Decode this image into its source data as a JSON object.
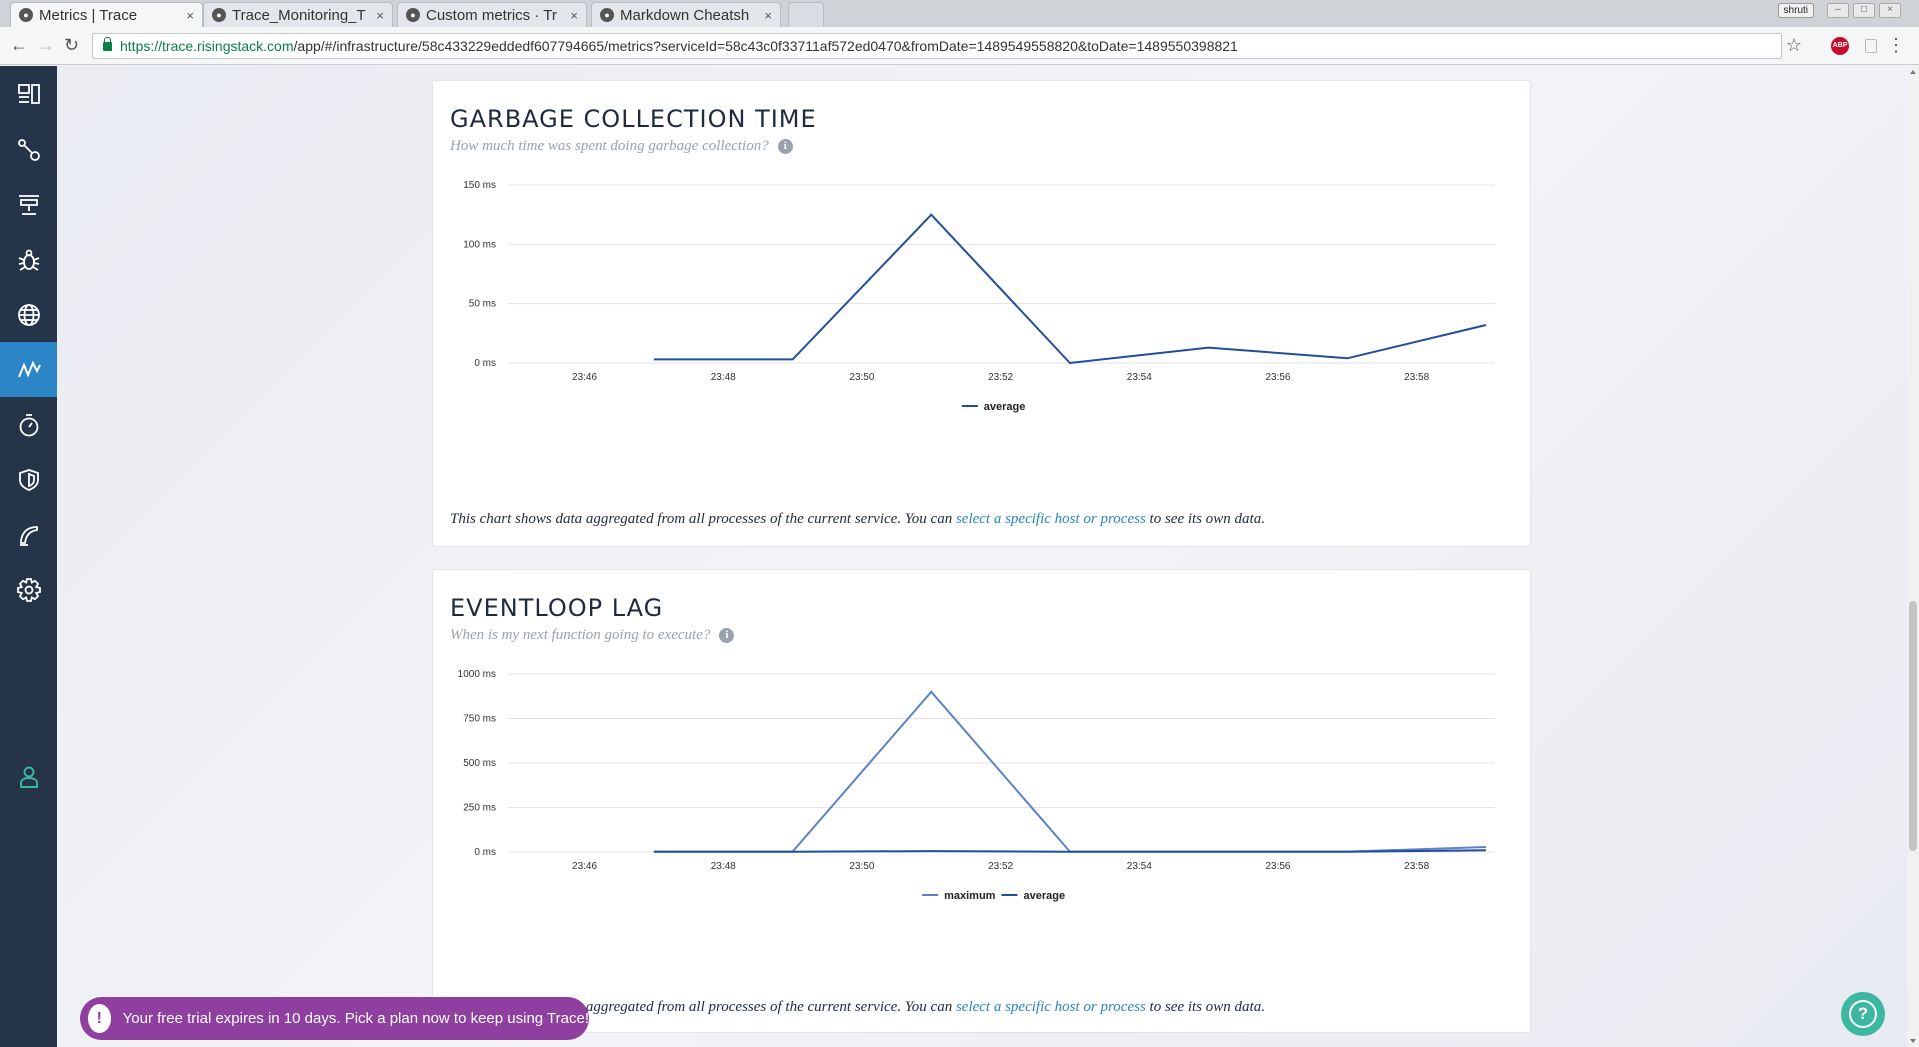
{
  "browser": {
    "tabs": [
      {
        "label": "Metrics | Trace",
        "close": "×"
      },
      {
        "label": "Trace_Monitoring_T",
        "close": "×"
      },
      {
        "label": "Custom metrics · Tr",
        "close": "×"
      },
      {
        "label": "Markdown Cheatsh",
        "close": "×"
      }
    ],
    "profile": "shruti",
    "url_host": "https://trace.risingstack.com",
    "url_path": "/app/#/infrastructure/58c433229eddedf607794665/metrics?serviceId=58c43c0f33711af572ed0470&fromDate=1489549558820&toDate=1489550398821",
    "abp_badge": "ABP",
    "icons": {
      "back": "back-arrow-icon",
      "forward": "forward-arrow-icon",
      "reload": "reload-icon",
      "star": "bookmark-star-icon",
      "menu": "menu-icon"
    }
  },
  "sidebar": {
    "items": [
      {
        "name": "dashboard",
        "icon": "dashboard-icon"
      },
      {
        "name": "service-map",
        "icon": "topology-icon"
      },
      {
        "name": "infrastructure",
        "icon": "server-icon"
      },
      {
        "name": "errors",
        "icon": "bug-icon"
      },
      {
        "name": "transactions",
        "icon": "globe-icon"
      },
      {
        "name": "metrics",
        "icon": "line-chart-icon",
        "active": true
      },
      {
        "name": "profiler",
        "icon": "stopwatch-icon"
      },
      {
        "name": "security",
        "icon": "shield-icon"
      },
      {
        "name": "alerting",
        "icon": "megaphone-icon"
      },
      {
        "name": "settings",
        "icon": "gear-icon"
      },
      {
        "name": "account",
        "icon": "user-icon"
      }
    ],
    "accent": "#2b85c7",
    "background": "#253448"
  },
  "cards": [
    {
      "title": "GARBAGE COLLECTION TIME",
      "subtitle": "How much time was spent doing garbage collection?",
      "foot_text": "This chart shows data aggregated from all processes of the current service. You can ",
      "foot_link": "select a specific host or process",
      "foot_end": " to see its own data."
    },
    {
      "title": "EVENTLOOP LAG",
      "subtitle": "When is my next function going to execute?",
      "foot_text": "This chart shows data aggregated from all processes of the current service. You can ",
      "foot_link": "select a specific host or process",
      "foot_end": " to see its own data."
    }
  ],
  "chart_data": [
    {
      "type": "line",
      "x": [
        "23:47",
        "23:49",
        "23:51",
        "23:53",
        "23:55",
        "23:57",
        "23:59"
      ],
      "xticks": [
        "23:46",
        "23:48",
        "23:50",
        "23:52",
        "23:54",
        "23:56",
        "23:58"
      ],
      "yticks": [
        "0 ms",
        "50 ms",
        "100 ms",
        "150 ms"
      ],
      "ylim": [
        0,
        150
      ],
      "grid": true,
      "legend_position": "bottom-center",
      "series": [
        {
          "name": "average",
          "values": [
            3,
            3,
            125,
            0,
            13,
            4,
            32
          ],
          "color": "#1f4e9c"
        }
      ]
    },
    {
      "type": "line",
      "x": [
        "23:47",
        "23:49",
        "23:51",
        "23:53",
        "23:55",
        "23:57",
        "23:59"
      ],
      "xticks": [
        "23:46",
        "23:48",
        "23:50",
        "23:52",
        "23:54",
        "23:56",
        "23:58"
      ],
      "yticks": [
        "0 ms",
        "250 ms",
        "500 ms",
        "750 ms",
        "1000 ms"
      ],
      "ylim": [
        0,
        1000
      ],
      "grid": true,
      "legend_position": "bottom-center",
      "series": [
        {
          "name": "maximum",
          "values": [
            2,
            2,
            900,
            2,
            2,
            2,
            28
          ],
          "color": "#5b83c9"
        },
        {
          "name": "average",
          "values": [
            1,
            1,
            5,
            1,
            1,
            1,
            10
          ],
          "color": "#1f4e9c"
        }
      ]
    }
  ],
  "trial_banner": {
    "icon": "!",
    "text": "Your free trial expires in 10 days. Pick a plan now to keep using Trace!"
  },
  "help_button": {
    "icon": "?"
  }
}
